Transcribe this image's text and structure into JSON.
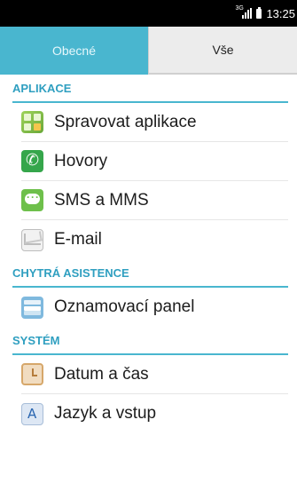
{
  "status_bar": {
    "network": "3G",
    "time": "13:25"
  },
  "tabs": [
    {
      "label": "Obecné",
      "active": true
    },
    {
      "label": "Vše",
      "active": false
    }
  ],
  "sections": [
    {
      "header": "APLIKACE",
      "items": [
        {
          "label": "Spravovat aplikace",
          "icon": "apps-icon"
        },
        {
          "label": "Hovory",
          "icon": "phone-icon"
        },
        {
          "label": "SMS a MMS",
          "icon": "sms-icon"
        },
        {
          "label": "E-mail",
          "icon": "mail-icon"
        }
      ]
    },
    {
      "header": "CHYTRÁ ASISTENCE",
      "items": [
        {
          "label": "Oznamovací panel",
          "icon": "notification-panel-icon"
        }
      ]
    },
    {
      "header": "SYSTÉM",
      "items": [
        {
          "label": "Datum a čas",
          "icon": "clock-icon"
        },
        {
          "label": "Jazyk a vstup",
          "icon": "language-icon"
        }
      ]
    }
  ],
  "colors": {
    "accent": "#49b6cf",
    "header_text": "#2f9fc0"
  }
}
